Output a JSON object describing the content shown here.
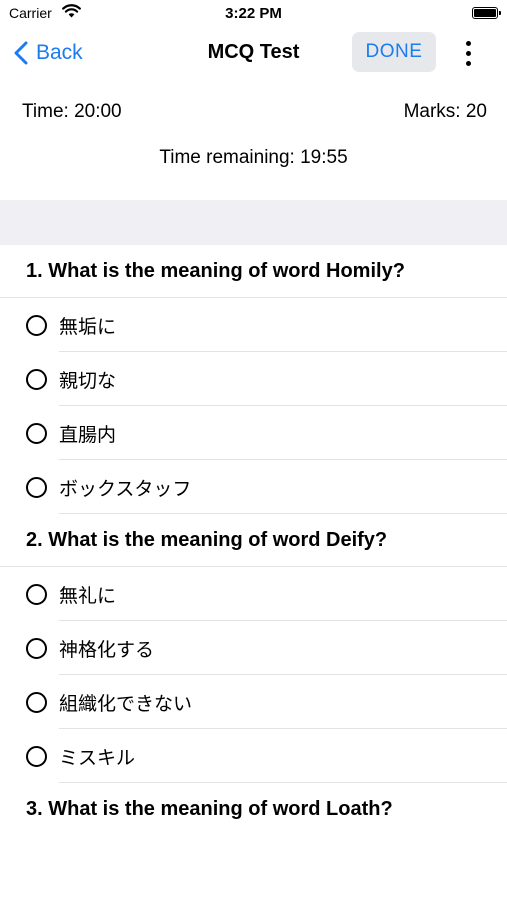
{
  "status": {
    "carrier": "Carrier",
    "time": "3:22 PM"
  },
  "nav": {
    "back_label": "Back",
    "title": "MCQ Test",
    "done_label": "DONE"
  },
  "info": {
    "time": "Time: 20:00",
    "marks": "Marks: 20",
    "remaining": "Time remaining: 19:55"
  },
  "questions": [
    {
      "title": "1. What is the meaning of word Homily?",
      "options": [
        "無垢に",
        "親切な",
        "直腸内",
        "ボックスタッフ"
      ]
    },
    {
      "title": "2. What is the meaning of word Deify?",
      "options": [
        "無礼に",
        "神格化する",
        "組織化できない",
        "ミスキル"
      ]
    },
    {
      "title": "3. What is the meaning of word Loath?",
      "options": []
    }
  ],
  "colors": {
    "accent": "#1a7cf0",
    "band": "#efeff4",
    "done_bg": "#e6e8ec"
  }
}
